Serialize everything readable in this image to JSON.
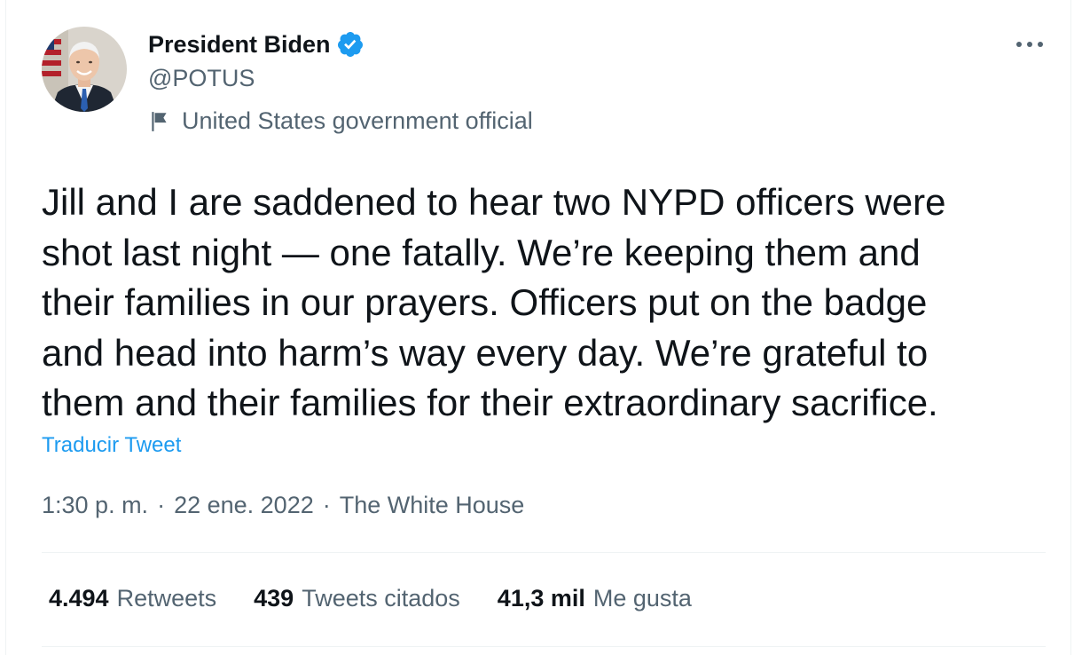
{
  "author": {
    "display_name": "President Biden",
    "handle": "@POTUS",
    "label": "United States government official",
    "avatar_icon": "portrait-avatar",
    "verified_icon": "verified-badge-icon"
  },
  "tweet": {
    "text": "Jill and I are saddened to hear two NYPD officers were\nshot last night — one fatally. We’re keeping them and\ntheir families in our prayers. Officers put on the badge\nand head into harm’s way every day. We’re grateful to\nthem and their families for their extraordinary sacrifice.",
    "translate_label": "Traducir Tweet",
    "time": "1:30 p. m.",
    "date": "22 ene. 2022",
    "source": "The White House",
    "separator": "·"
  },
  "stats": {
    "retweets_count": "4.494",
    "retweets_label": "Retweets",
    "quotes_count": "439",
    "quotes_label": "Tweets citados",
    "likes_count": "41,3 mil",
    "likes_label": "Me gusta"
  },
  "colors": {
    "accent": "#1d9bf0",
    "text": "#0f1419",
    "secondary": "#536471",
    "border": "#eff3f4"
  }
}
